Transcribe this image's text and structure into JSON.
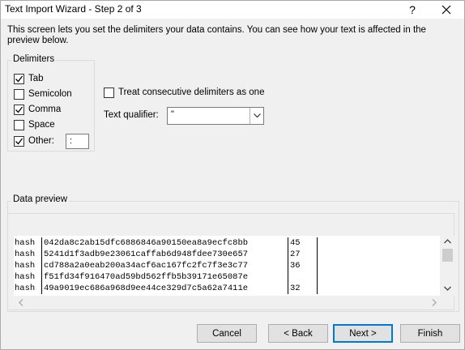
{
  "window": {
    "title": "Text Import Wizard - Step 2 of 3",
    "help_symbol": "?",
    "close_symbol": "✕"
  },
  "intro_text": "This screen lets you set the delimiters your data contains.  You can see how your text is affected in the preview below.",
  "delimiters": {
    "legend": "Delimiters",
    "items": [
      {
        "label": "Tab",
        "checked": true
      },
      {
        "label": "Semicolon",
        "checked": false
      },
      {
        "label": "Comma",
        "checked": true
      },
      {
        "label": "Space",
        "checked": false
      },
      {
        "label": "Other:",
        "checked": true
      }
    ],
    "other_value": ":"
  },
  "consecutive": {
    "label": "Treat consecutive delimiters as one",
    "checked": false
  },
  "qualifier": {
    "label": "Text qualifier:",
    "value": "\""
  },
  "preview": {
    "legend": "Data preview",
    "rows": [
      [
        "hash",
        "042da8c2ab15dfc6886846a90150ea8a9ecfc8bb",
        "45",
        ""
      ],
      [
        "hash",
        "5241d1f3adb9e23061caffab6d948fdee730e657",
        "27",
        ""
      ],
      [
        "hash",
        "cd788a2a0eab200a34acf6ac167fc2fc7f3e3c77",
        "36",
        ""
      ],
      [
        "hash",
        "f51fd34f916470ad59bd562ffb5b39171e65087e",
        "",
        ""
      ],
      [
        "hash",
        "49a9019ec686a968d9ee44ce329d7c5a62a7411e",
        "32",
        ""
      ]
    ]
  },
  "buttons": {
    "cancel": "Cancel",
    "back": "< Back",
    "next": "Next >",
    "finish": "Finish"
  },
  "colors": {
    "dialog_bg": "#f0f0f0",
    "default_button_border": "#0078d7"
  }
}
